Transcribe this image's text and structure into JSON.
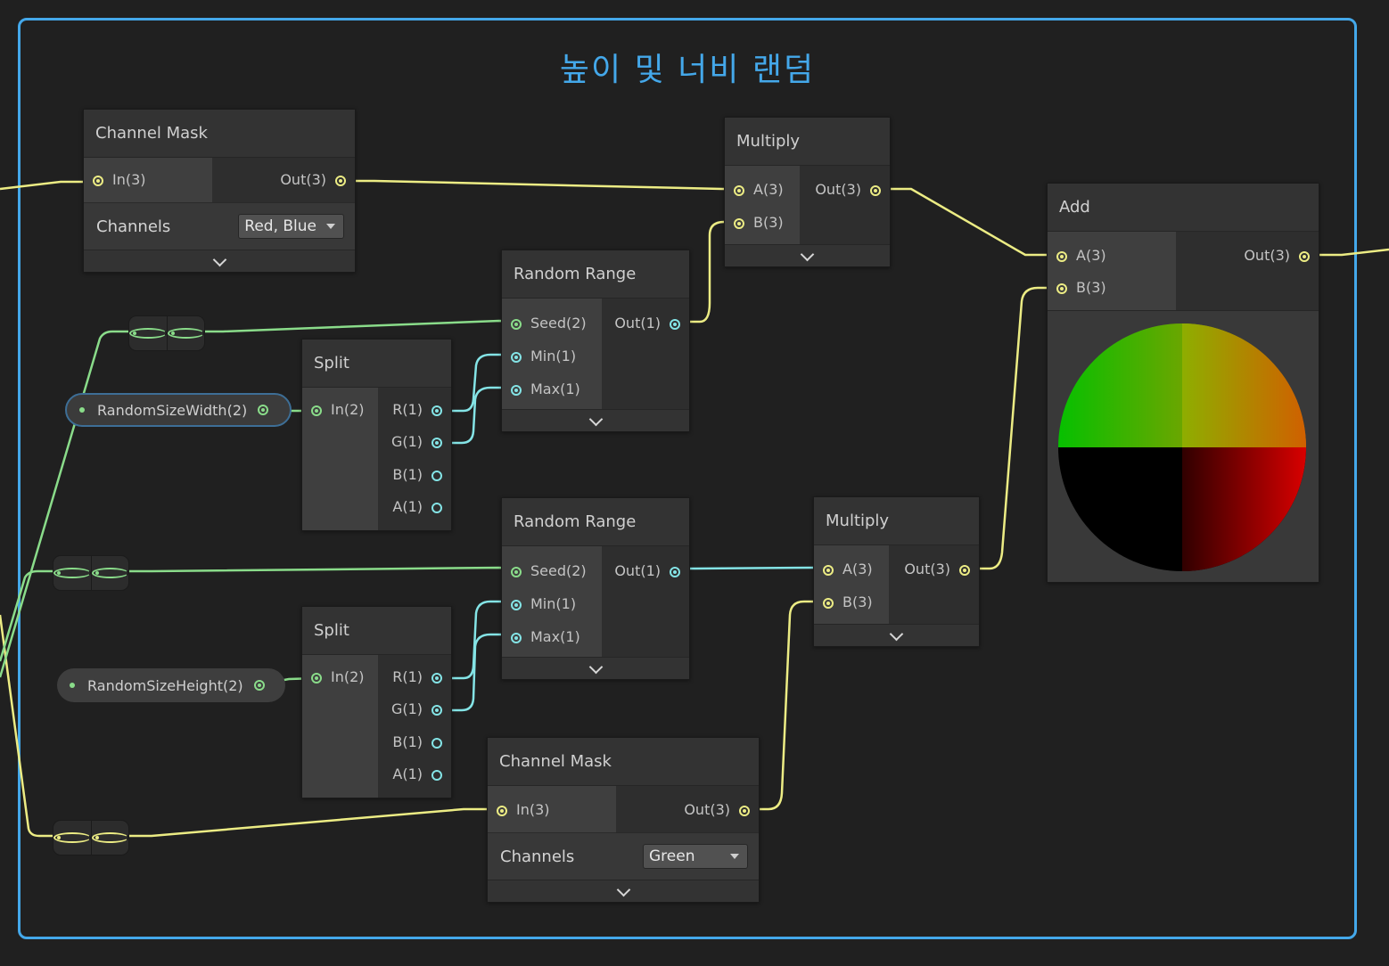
{
  "group": {
    "title": "높이 및 너비 랜덤"
  },
  "colors": {
    "group_border": "#44a8ea",
    "vector3_wire": "#ecec84",
    "float_wire": "#84e4e6",
    "vector2_wire": "#8adc8a",
    "background": "#202020"
  },
  "nodes": {
    "channel_mask_1": {
      "title": "Channel Mask",
      "in": "In(3)",
      "out": "Out(3)",
      "setting_label": "Channels",
      "setting_value": "Red, Blue"
    },
    "multiply_1": {
      "title": "Multiply",
      "in_a": "A(3)",
      "in_b": "B(3)",
      "out": "Out(3)"
    },
    "add": {
      "title": "Add",
      "in_a": "A(3)",
      "in_b": "B(3)",
      "out": "Out(3)"
    },
    "random_range_1": {
      "title": "Random Range",
      "seed": "Seed(2)",
      "min": "Min(1)",
      "max": "Max(1)",
      "out": "Out(1)"
    },
    "split_1": {
      "title": "Split",
      "in": "In(2)",
      "r": "R(1)",
      "g": "G(1)",
      "b": "B(1)",
      "a": "A(1)"
    },
    "random_range_2": {
      "title": "Random Range",
      "seed": "Seed(2)",
      "min": "Min(1)",
      "max": "Max(1)",
      "out": "Out(1)"
    },
    "multiply_2": {
      "title": "Multiply",
      "in_a": "A(3)",
      "in_b": "B(3)",
      "out": "Out(3)"
    },
    "split_2": {
      "title": "Split",
      "in": "In(2)",
      "r": "R(1)",
      "g": "G(1)",
      "b": "B(1)",
      "a": "A(1)"
    },
    "channel_mask_2": {
      "title": "Channel Mask",
      "in": "In(3)",
      "out": "Out(3)",
      "setting_label": "Channels",
      "setting_value": "Green"
    }
  },
  "properties": {
    "random_size_width": "RandomSizeWidth(2)",
    "random_size_height": "RandomSizeHeight(2)"
  },
  "icons": {
    "expand": "chevron-down-icon",
    "dropdown": "caret-down-icon"
  }
}
